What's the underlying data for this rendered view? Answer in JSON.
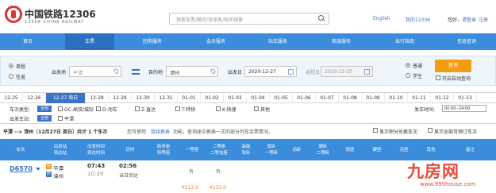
{
  "header": {
    "brand_cn": "中国铁路12306",
    "brand_en": "12306 CHINA RAILWAY",
    "search_placeholder": "搜索车票/餐饮/常旅客/相关规章",
    "lang": "English",
    "my": "我的12306",
    "greeting": "您好，",
    "login": "请登录",
    "register": "注册"
  },
  "nav": [
    "首页",
    "车票",
    "团购服务",
    "会员服务",
    "站车服务",
    "商旅服务",
    "出行指南",
    "信息查询"
  ],
  "query": {
    "trip_types": [
      "单程",
      "往返"
    ],
    "from_label": "出发地",
    "from_value": "平潭",
    "to_label": "目的地",
    "to_value": "漳州",
    "depart_label": "出发日",
    "depart_value": "2020-12-27",
    "return_label": "返程日",
    "return_value": "2020-12-25",
    "passenger_types": [
      "普通",
      "学生"
    ],
    "query_button": "查询",
    "auto_query": "开启自动查询"
  },
  "dates": [
    "12-25",
    "12-26",
    "12-27 周日",
    "12-28",
    "12-29",
    "12-30",
    "12-31",
    "01-01",
    "01-02",
    "01-03",
    "01-04",
    "01-05",
    "01-06",
    "01-07",
    "01-08",
    "01-09",
    "01-10",
    "01-11",
    "01-12",
    "01-13"
  ],
  "filters": {
    "train_type_label": "车次类型:",
    "all": "全部",
    "train_types": [
      "GC-高铁/城际",
      "D-动车",
      "Z-直达",
      "T-特快",
      "K-快速",
      "其他"
    ],
    "depart_time_label": "发车时间:",
    "depart_time_value": "00:00--24:00",
    "depart_station_label": "出发车站:",
    "stations": [
      "平潭"
    ]
  },
  "summary": {
    "route": "平潭 --> 漳州（12月27日 周日）共计 1 个车次",
    "hint_pre": "您可使用",
    "hint_link": "接续换乘",
    "hint_post": "功能，查询途中换乘一次的部分列车余票情况。",
    "opt1": "显示积分兑换车次",
    "opt2": "显示全部可预订车次"
  },
  "columns": [
    [
      "车次"
    ],
    [
      "出发站",
      "到达站"
    ],
    [
      "出发时间",
      "到达时间"
    ],
    [
      "历时"
    ],
    [
      "商务座",
      "特等座"
    ],
    [
      "一等座"
    ],
    [
      "二等座",
      "二等包座"
    ],
    [
      "高级",
      "软卧"
    ],
    [
      "软卧",
      "一等卧"
    ],
    [
      "动卧"
    ],
    [
      "硬卧",
      "二等卧"
    ],
    [
      "软座"
    ],
    [
      "硬座"
    ],
    [
      "无座"
    ],
    [
      "其他"
    ],
    [
      "备注"
    ]
  ],
  "row": {
    "train_no": "D6570",
    "from_badge": "始",
    "to_badge": "终",
    "from_station": "平潭",
    "to_station": "漳州",
    "depart": "07:43",
    "arrive": "10:39",
    "duration": "02:56",
    "duration_note": "当日到达",
    "first_class": "有",
    "second_class": "有",
    "first_price": "¥212.0",
    "second_price": "¥133.0"
  },
  "watermark": {
    "text": "九房网",
    "url": "www.999house.com"
  },
  "colors": {
    "nav_blue": "#3b8ddc",
    "link_blue": "#3b73c8",
    "orange": "#f39c12",
    "brand_red": "#d33"
  }
}
